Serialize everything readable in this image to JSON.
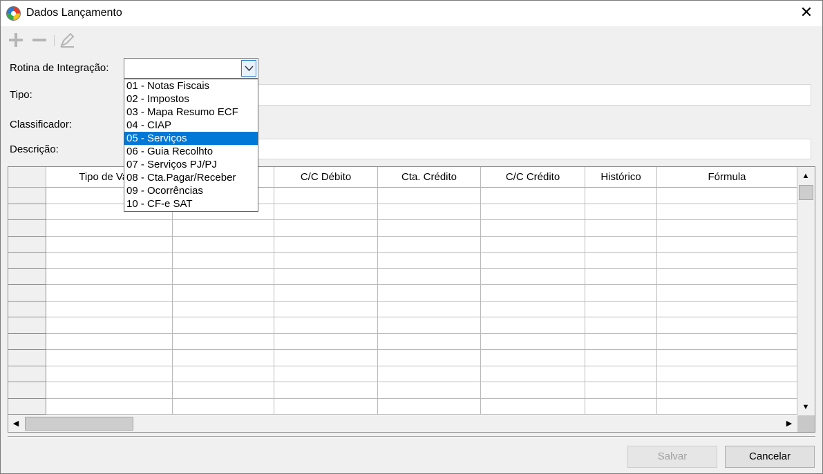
{
  "window": {
    "title": "Dados Lançamento",
    "close_glyph": "✕"
  },
  "toolbar": {
    "icons": [
      "add-icon",
      "remove-icon",
      "edit-icon"
    ]
  },
  "form": {
    "rotina_label": "Rotina de Integração:",
    "tipo_label": "Tipo:",
    "classificador_label": "Classificador:",
    "descricao_label": "Descrição:",
    "rotina_value": "",
    "tipo_value": "",
    "descricao_value": ""
  },
  "dropdown": {
    "items": [
      "01 - Notas Fiscais",
      "02 - Impostos",
      "03 - Mapa Resumo ECF",
      "04 - CIAP",
      "05 - Serviços",
      "06 - Guia Recolhto",
      "07 - Serviços PJ/PJ",
      "08 - Cta.Pagar/Receber",
      "09 - Ocorrências",
      "10 - CF-e SAT"
    ],
    "selected_index": 4
  },
  "grid": {
    "columns": [
      "Tipo de Valor",
      "",
      "C/C Débito",
      "Cta. Crédito",
      "C/C Crédito",
      "Histórico",
      "Fórmula"
    ]
  },
  "buttons": {
    "salvar": "Salvar",
    "cancelar": "Cancelar"
  },
  "colors": {
    "selection": "#0078d7",
    "dropdown_button_border": "#2c7bd0"
  }
}
